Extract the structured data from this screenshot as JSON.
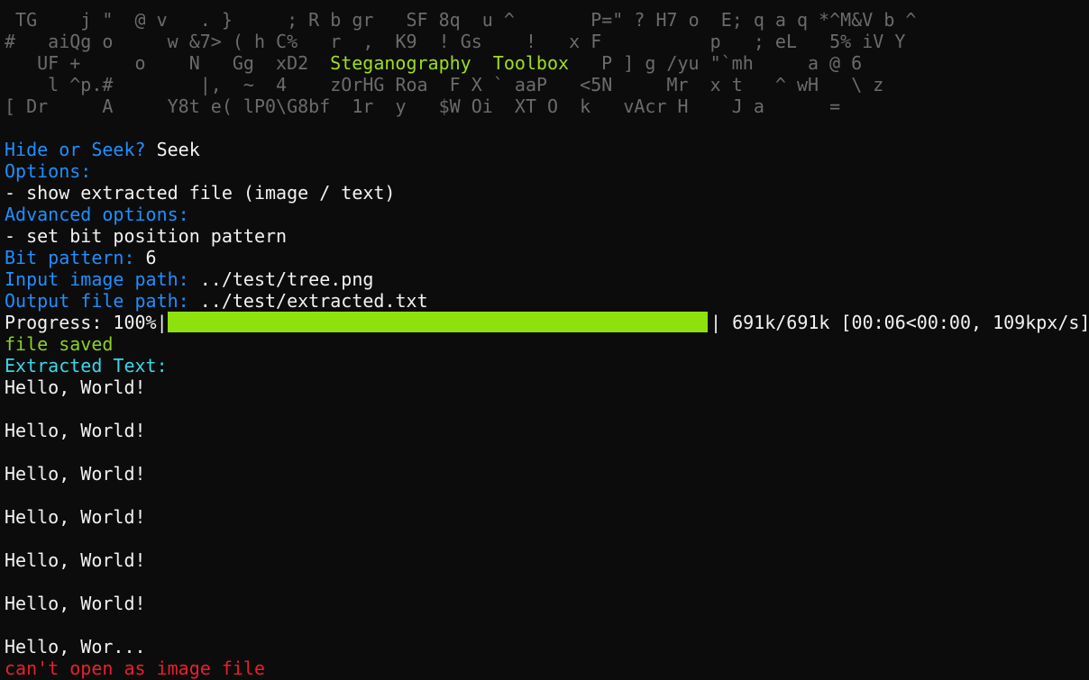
{
  "banner": {
    "lines": [
      " TG    j \"  @ v   . }     ; R b gr   SF 8q  u ^       P=\" ? H7 o  E; q a q *^M&V b ^",
      "#   aiQg o     w &7> ( h C%   r  ,  K9  ! Gs    !   x F          p   ; eL   5% iV Y",
      "   UF +     o    N   Gg  xD2",
      "    l ^p.#        |,  ~  4    zOrHG Roa  F X ` aaP   <5N     Mr  x t   ^ wH   \\ z",
      "[ Dr     A     Y8t e( lP0\\G8bf  1r  y   $W Oi  XT O  k   vAcr H    J a      ="
    ],
    "title": "Steganography  Toolbox",
    "line3_tail": "   P ] g /yu \"`mh     a @ 6",
    "colors": {
      "dim": "#5a5a5a",
      "red": "#c6262e",
      "purple": "#8a3fd0",
      "yellow": "#c9a21c",
      "blue": "#2d6fd6",
      "teal": "#2fb0b0",
      "green": "#6aa84f",
      "title": "#9ddf1c"
    }
  },
  "session": {
    "hide_or_seek_label": "Hide or Seek?",
    "hide_or_seek_value": "Seek",
    "options_label": "Options:",
    "option_1": "- show extracted file (image / text)",
    "advanced_label": "Advanced options:",
    "advanced_1": "- set bit position pattern",
    "bit_pattern_label": "Bit pattern:",
    "bit_pattern_value": "6",
    "input_label": "Input image path:",
    "input_value": "../test/tree.png",
    "output_label": "Output file path:",
    "output_value": "../test/extracted.txt"
  },
  "progress": {
    "label": "Progress: 100%|",
    "right_text": "| 691k/691k [00:06<00:00, 109kpx/s]",
    "fraction": 1.0,
    "bar_color": "#8ee10d"
  },
  "result": {
    "saved_text": "file saved",
    "extracted_label": "Extracted Text:",
    "lines": [
      "Hello, World!",
      "",
      "Hello, World!",
      "",
      "Hello, World!",
      "",
      "Hello, World!",
      "",
      "Hello, World!",
      "",
      "Hello, World!",
      "",
      "Hello, Wor..."
    ],
    "error_text": "can't open as image file"
  }
}
